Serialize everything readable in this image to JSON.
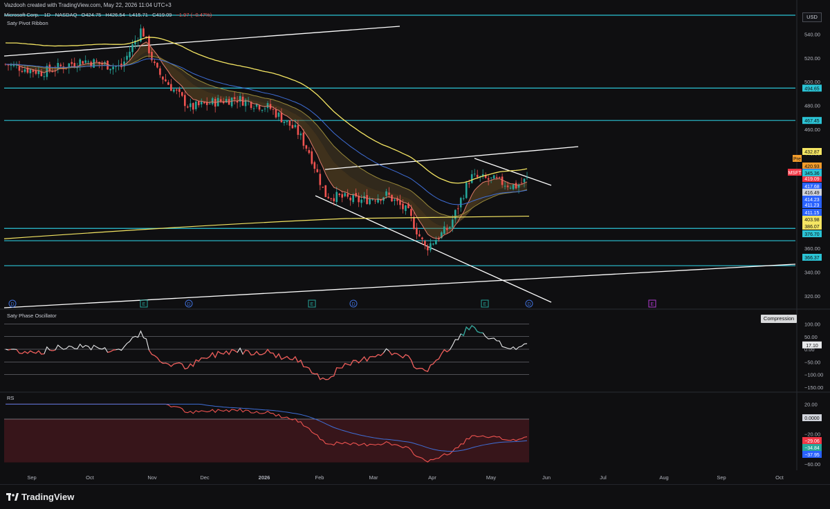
{
  "header": {
    "credit": "Vazdooh created with TradingView.com, May 22, 2026 11:04 UTC+3",
    "symbol": "Microsoft Corp. · 1D · NASDAQ",
    "ohlc": {
      "o": "O424.75",
      "h": "H426.54",
      "l": "L415.71",
      "c": "C419.09",
      "chg": "−1.97 (−0.47%)"
    },
    "currency": "USD"
  },
  "indicators": {
    "ribbon": "Saty Pivot Ribbon",
    "oscillator": "Saty Phase Oscillator",
    "rs": "RS",
    "compression_label": "Compression"
  },
  "branding": {
    "name": "TradingView"
  },
  "colors": {
    "background": "#0f0f11",
    "up": "#26a69a",
    "down": "#ef5350",
    "level_line": "#2bc4d6",
    "trend_line": "#ffffff",
    "yellow_ma": "#f5e663",
    "blue_ma": "#3f6fd8"
  },
  "chart_data": [
    {
      "type": "candlestick",
      "title": "Microsoft Corp. · 1D · NASDAQ",
      "ylim": [
        300,
        560
      ],
      "y_ticks": [
        320,
        340,
        360,
        380,
        400,
        420,
        440,
        460,
        480,
        500,
        520,
        540
      ],
      "x_ticks": [
        "Sep",
        "Oct",
        "Nov",
        "Dec",
        "2026",
        "Feb",
        "Mar",
        "Apr",
        "May",
        "Jun",
        "Jul",
        "Aug",
        "Sep",
        "Oct"
      ],
      "horizontal_levels": [
        494.65,
        467.45,
        376.7,
        366.37,
        345.36
      ],
      "price_labels": [
        {
          "text": "432.87",
          "kind": "yellow"
        },
        {
          "text": "Pre",
          "kind": "pre"
        },
        {
          "text": "420.93",
          "kind": "orange"
        },
        {
          "text": "419.09",
          "kind": "blue"
        },
        {
          "text": "MSFT",
          "kind": "red"
        },
        {
          "text": "419.09",
          "kind": "red"
        },
        {
          "text": "417.68",
          "kind": "blue"
        },
        {
          "text": "416.49",
          "kind": "gray"
        },
        {
          "text": "414.23",
          "kind": "blue"
        },
        {
          "text": "411.23",
          "kind": "blue"
        },
        {
          "text": "411.15",
          "kind": "blue"
        },
        {
          "text": "403.98",
          "kind": "yellow"
        },
        {
          "text": "386.07",
          "kind": "yellow"
        },
        {
          "text": "376.70",
          "kind": "cyan"
        },
        {
          "text": "366.37",
          "kind": "cyan"
        },
        {
          "text": "345.36",
          "kind": "cyan"
        }
      ],
      "event_markers": [
        "D",
        "E",
        "D",
        "E",
        "D",
        "E",
        "D",
        "E"
      ],
      "close_path": [
        {
          "x": "Aug 29",
          "y": 515
        },
        {
          "x": "Sep 15",
          "y": 508
        },
        {
          "x": "Oct 1",
          "y": 518
        },
        {
          "x": "Oct 15",
          "y": 512
        },
        {
          "x": "Oct 28",
          "y": 545
        },
        {
          "x": "Nov 5",
          "y": 510
        },
        {
          "x": "Nov 20",
          "y": 478
        },
        {
          "x": "Dec 5",
          "y": 483
        },
        {
          "x": "Dec 20",
          "y": 486
        },
        {
          "x": "Jan 6",
          "y": 478
        },
        {
          "x": "Jan 20",
          "y": 458
        },
        {
          "x": "Jan 29",
          "y": 440
        },
        {
          "x": "Feb 5",
          "y": 405
        },
        {
          "x": "Feb 20",
          "y": 400
        },
        {
          "x": "Mar 5",
          "y": 405
        },
        {
          "x": "Mar 20",
          "y": 390
        },
        {
          "x": "Mar 30",
          "y": 360
        },
        {
          "x": "Apr 10",
          "y": 378
        },
        {
          "x": "Apr 20",
          "y": 420
        },
        {
          "x": "May 1",
          "y": 417
        },
        {
          "x": "May 10",
          "y": 412
        },
        {
          "x": "May 21",
          "y": 419.09
        }
      ]
    },
    {
      "type": "line",
      "title": "Saty Phase Oscillator",
      "ylim": [
        -150,
        100
      ],
      "y_ticks": [
        100,
        50,
        0,
        -50,
        -100,
        -150
      ],
      "current_value": "17.10"
    },
    {
      "type": "line",
      "title": "RS",
      "ylim": [
        -60,
        20
      ],
      "y_ticks": [
        20,
        0,
        -20,
        -40,
        -60
      ],
      "value_labels": [
        "0.0000",
        "−29.06",
        "−34.84",
        "−37.95"
      ]
    }
  ]
}
